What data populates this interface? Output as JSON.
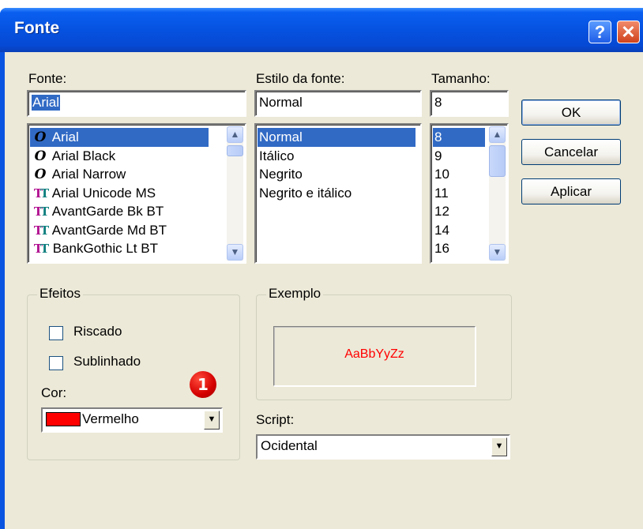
{
  "window": {
    "title": "Fonte",
    "help_glyph": "?",
    "close_glyph": "✕"
  },
  "font": {
    "label": "Fonte:",
    "value": "Arial",
    "items": [
      {
        "name": "Arial",
        "icon": "opentype-icon",
        "glyph": "O",
        "selected": true
      },
      {
        "name": "Arial Black",
        "icon": "opentype-icon",
        "glyph": "O",
        "selected": false
      },
      {
        "name": "Arial Narrow",
        "icon": "opentype-icon",
        "glyph": "O",
        "selected": false
      },
      {
        "name": "Arial Unicode MS",
        "icon": "truetype-icon",
        "glyph": "T",
        "selected": false
      },
      {
        "name": "AvantGarde Bk BT",
        "icon": "truetype-icon",
        "glyph": "T",
        "selected": false
      },
      {
        "name": "AvantGarde Md BT",
        "icon": "truetype-icon",
        "glyph": "T",
        "selected": false
      },
      {
        "name": "BankGothic Lt BT",
        "icon": "truetype-icon",
        "glyph": "T",
        "selected": false
      }
    ]
  },
  "style": {
    "label": "Estilo da fonte:",
    "value": "Normal",
    "items": [
      "Normal",
      "Itálico",
      "Negrito",
      "Negrito e itálico"
    ],
    "selected_index": 0
  },
  "size": {
    "label": "Tamanho:",
    "value": "8",
    "items": [
      "8",
      "9",
      "10",
      "11",
      "12",
      "14",
      "16"
    ],
    "selected_index": 0
  },
  "buttons": {
    "ok": "OK",
    "cancel": "Cancelar",
    "apply": "Aplicar"
  },
  "effects": {
    "label": "Efeitos",
    "strikeout": "Riscado",
    "underline": "Sublinhado",
    "strikeout_checked": false,
    "underline_checked": false,
    "color_label": "Cor:",
    "color_value": "Vermelho",
    "color_hex": "#ff0000"
  },
  "sample": {
    "label": "Exemplo",
    "text": "AaBbYyZz"
  },
  "script": {
    "label": "Script:",
    "value": "Ocidental"
  },
  "annotation": {
    "badge": "1"
  },
  "colors": {
    "titlebar": "#0a54e2",
    "dialog_bg": "#ece9d8",
    "selection": "#316ac5",
    "badge": "#d40000"
  }
}
